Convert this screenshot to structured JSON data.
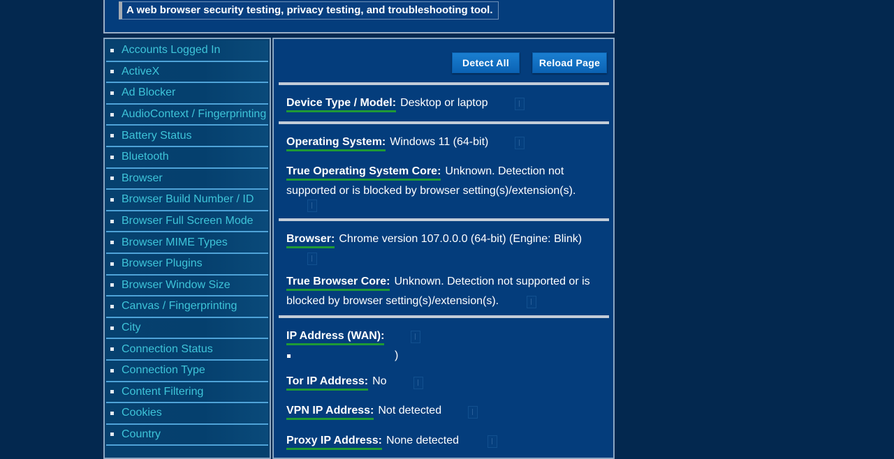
{
  "header": {
    "tagline": "A web browser security testing, privacy testing, and troubleshooting tool."
  },
  "sidebar": {
    "items": [
      {
        "label": "Accounts Logged In"
      },
      {
        "label": "ActiveX"
      },
      {
        "label": "Ad Blocker"
      },
      {
        "label": "AudioContext / Fingerprinting"
      },
      {
        "label": "Battery Status"
      },
      {
        "label": "Bluetooth"
      },
      {
        "label": "Browser"
      },
      {
        "label": "Browser Build Number / ID"
      },
      {
        "label": "Browser Full Screen Mode"
      },
      {
        "label": "Browser MIME Types"
      },
      {
        "label": "Browser Plugins"
      },
      {
        "label": "Browser Window Size"
      },
      {
        "label": "Canvas / Fingerprinting"
      },
      {
        "label": "City"
      },
      {
        "label": "Connection Status"
      },
      {
        "label": "Connection Type"
      },
      {
        "label": "Content Filtering"
      },
      {
        "label": "Cookies"
      },
      {
        "label": "Country"
      }
    ]
  },
  "toolbar": {
    "detect_all_label": "Detect All",
    "reload_page_label": "Reload Page"
  },
  "results": {
    "device": {
      "key": "Device Type / Model:",
      "value": "Desktop or laptop"
    },
    "os": {
      "key": "Operating System:",
      "value": "Windows 11 (64-bit)"
    },
    "true_os": {
      "key": "True Operating System Core:",
      "value": "Unknown. Detection not supported or is blocked by browser setting(s)/extension(s)."
    },
    "browser": {
      "key": "Browser:",
      "value": "Chrome version 107.0.0.0 (64-bit) (Engine: Blink)"
    },
    "true_browser": {
      "key": "True Browser Core:",
      "value": "Unknown. Detection not supported or is blocked by browser setting(s)/extension(s)."
    },
    "ip_wan": {
      "key": "IP Address (WAN):",
      "value": ")"
    },
    "tor": {
      "key": "Tor IP Address:",
      "value": "No"
    },
    "vpn": {
      "key": "VPN IP Address:",
      "value": "Not detected"
    },
    "proxy": {
      "key": "Proxy IP Address:",
      "value": "None detected"
    }
  },
  "colors": {
    "page_bg": "#03284f",
    "panel_bg": "#043d7c",
    "sidebar_link": "#3ec4d9",
    "button": "#1a7fd1",
    "underline_accent": "#1f9a35"
  }
}
